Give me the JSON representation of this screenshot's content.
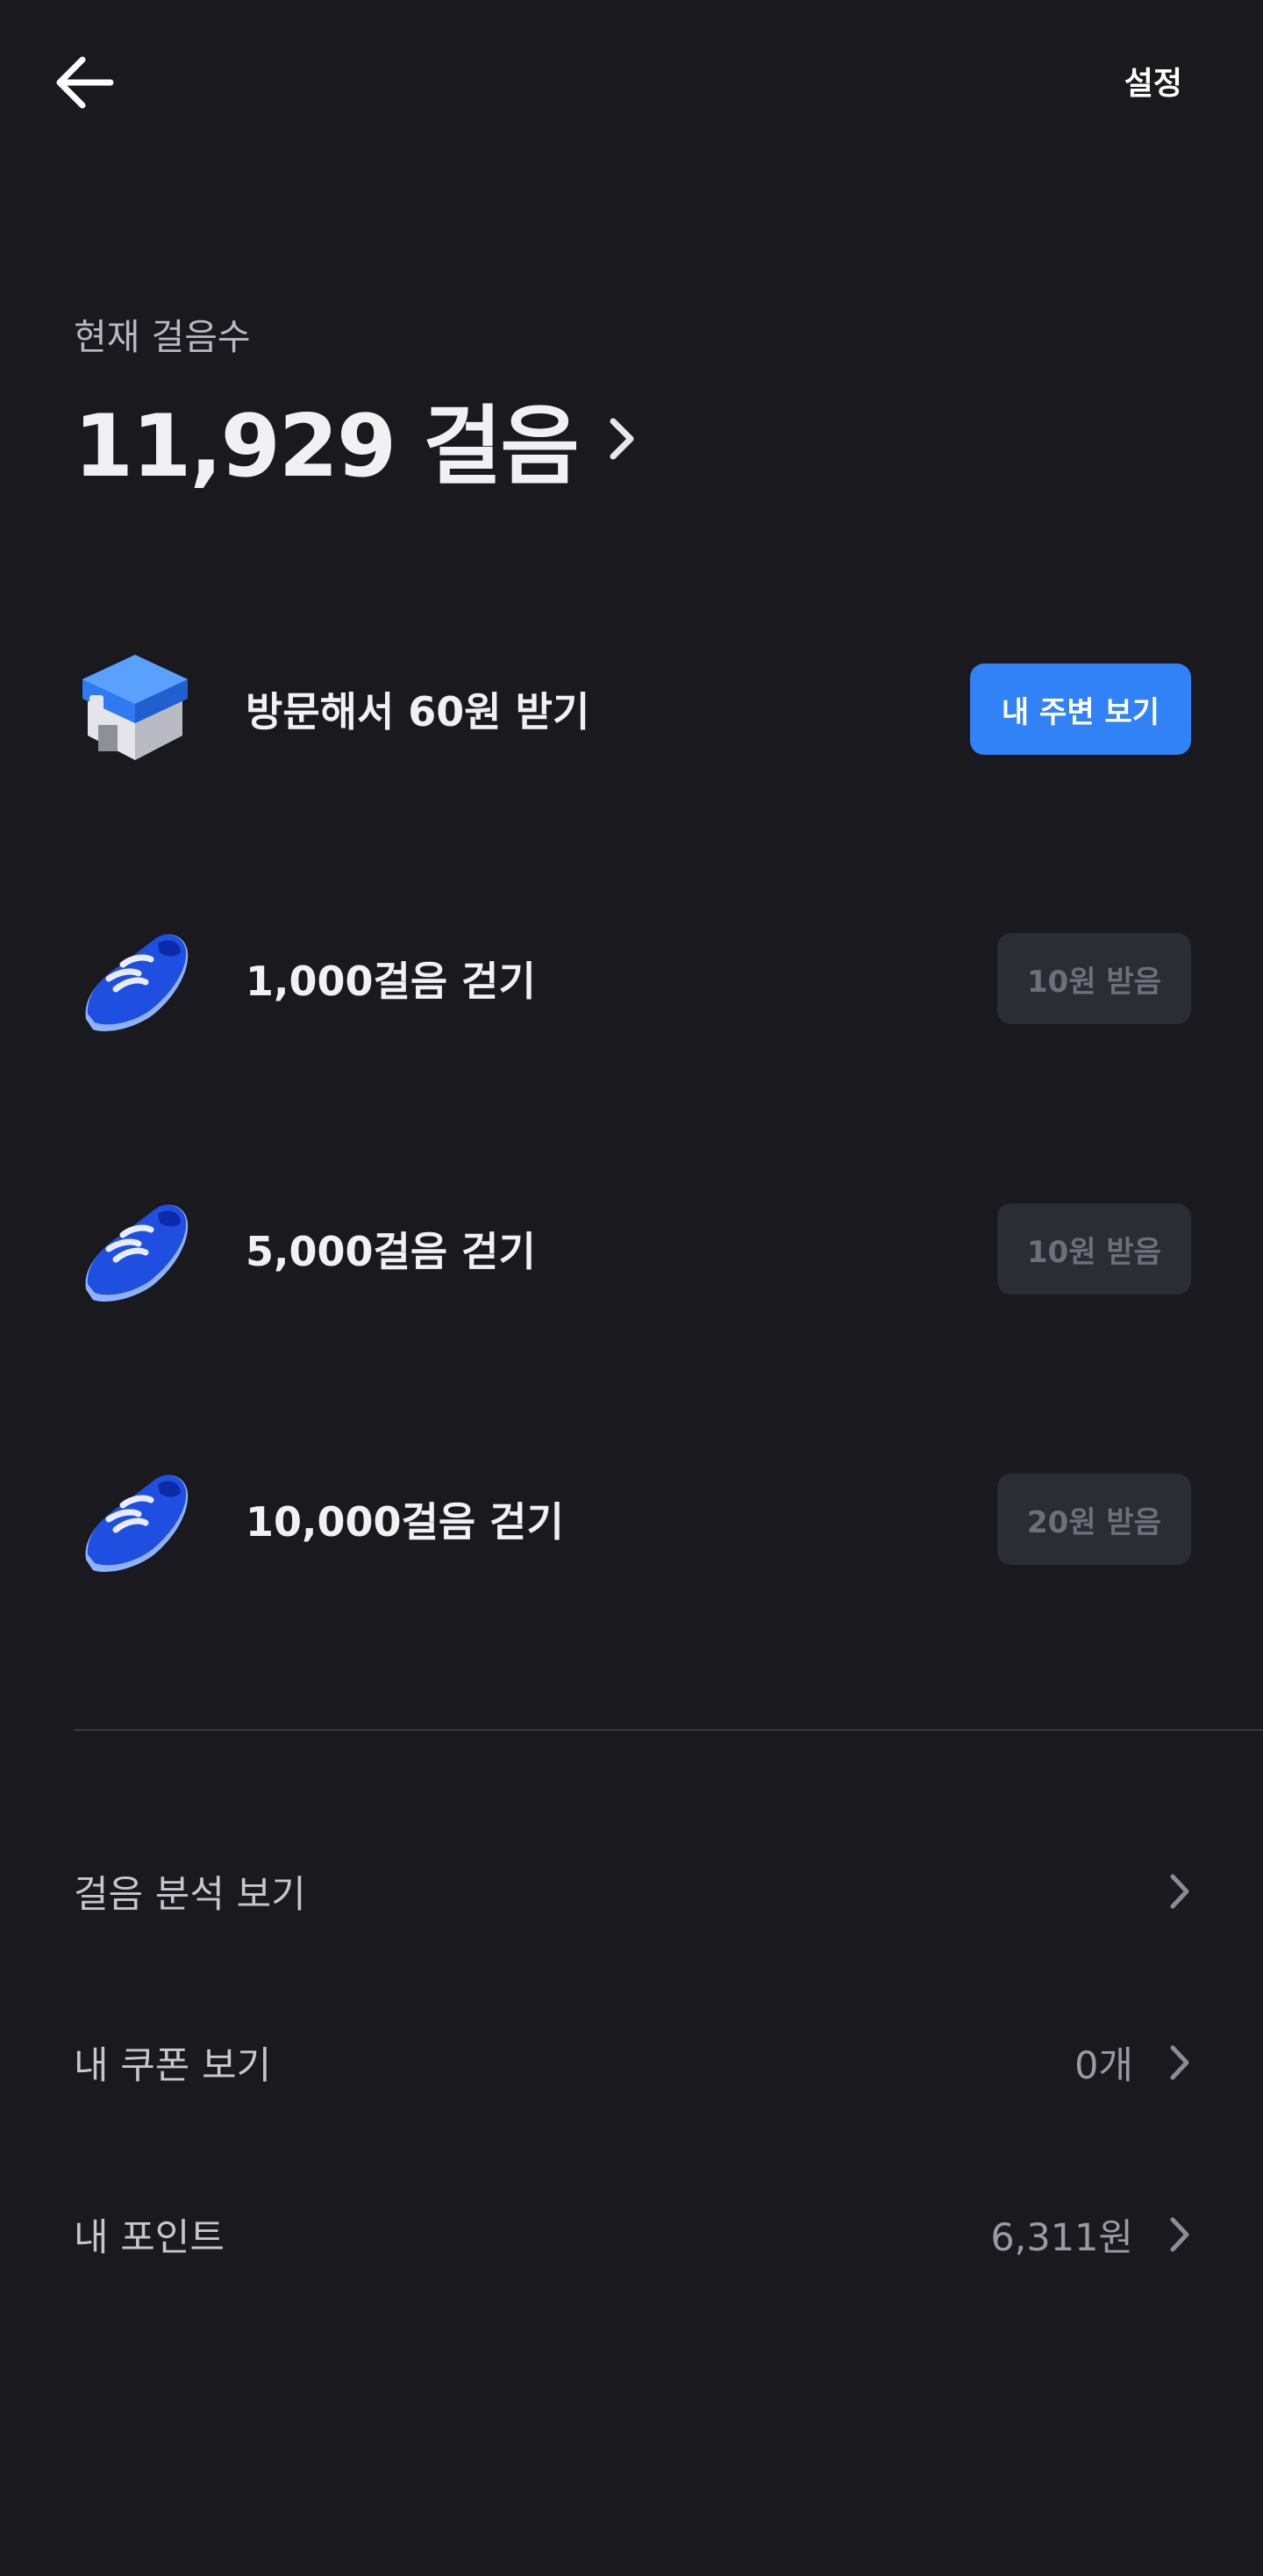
{
  "header": {
    "back_icon": "arrow-left-icon",
    "settings_label": "설정"
  },
  "steps": {
    "label": "현재 걸음수",
    "value": "11,929 걸음"
  },
  "missions": [
    {
      "icon": "store-building-icon",
      "title": "방문해서 60원 받기",
      "button": "내 주변 보기",
      "button_state": "active"
    },
    {
      "icon": "sneaker-icon",
      "title": "1,000걸음 걷기",
      "button": "10원 받음",
      "button_state": "disabled"
    },
    {
      "icon": "sneaker-icon",
      "title": "5,000걸음 걷기",
      "button": "10원 받음",
      "button_state": "disabled"
    },
    {
      "icon": "sneaker-icon",
      "title": "10,000걸음 걷기",
      "button": "20원 받음",
      "button_state": "disabled"
    }
  ],
  "menu": [
    {
      "label": "걸음 분석 보기",
      "value": ""
    },
    {
      "label": "내 쿠폰 보기",
      "value": "0개"
    },
    {
      "label": "내 포인트",
      "value": "6,311원"
    }
  ],
  "colors": {
    "background": "#19191e",
    "primary": "#3182f6",
    "disabled_button": "#2c2c35",
    "shoe_blue": "#1f4fe0"
  }
}
